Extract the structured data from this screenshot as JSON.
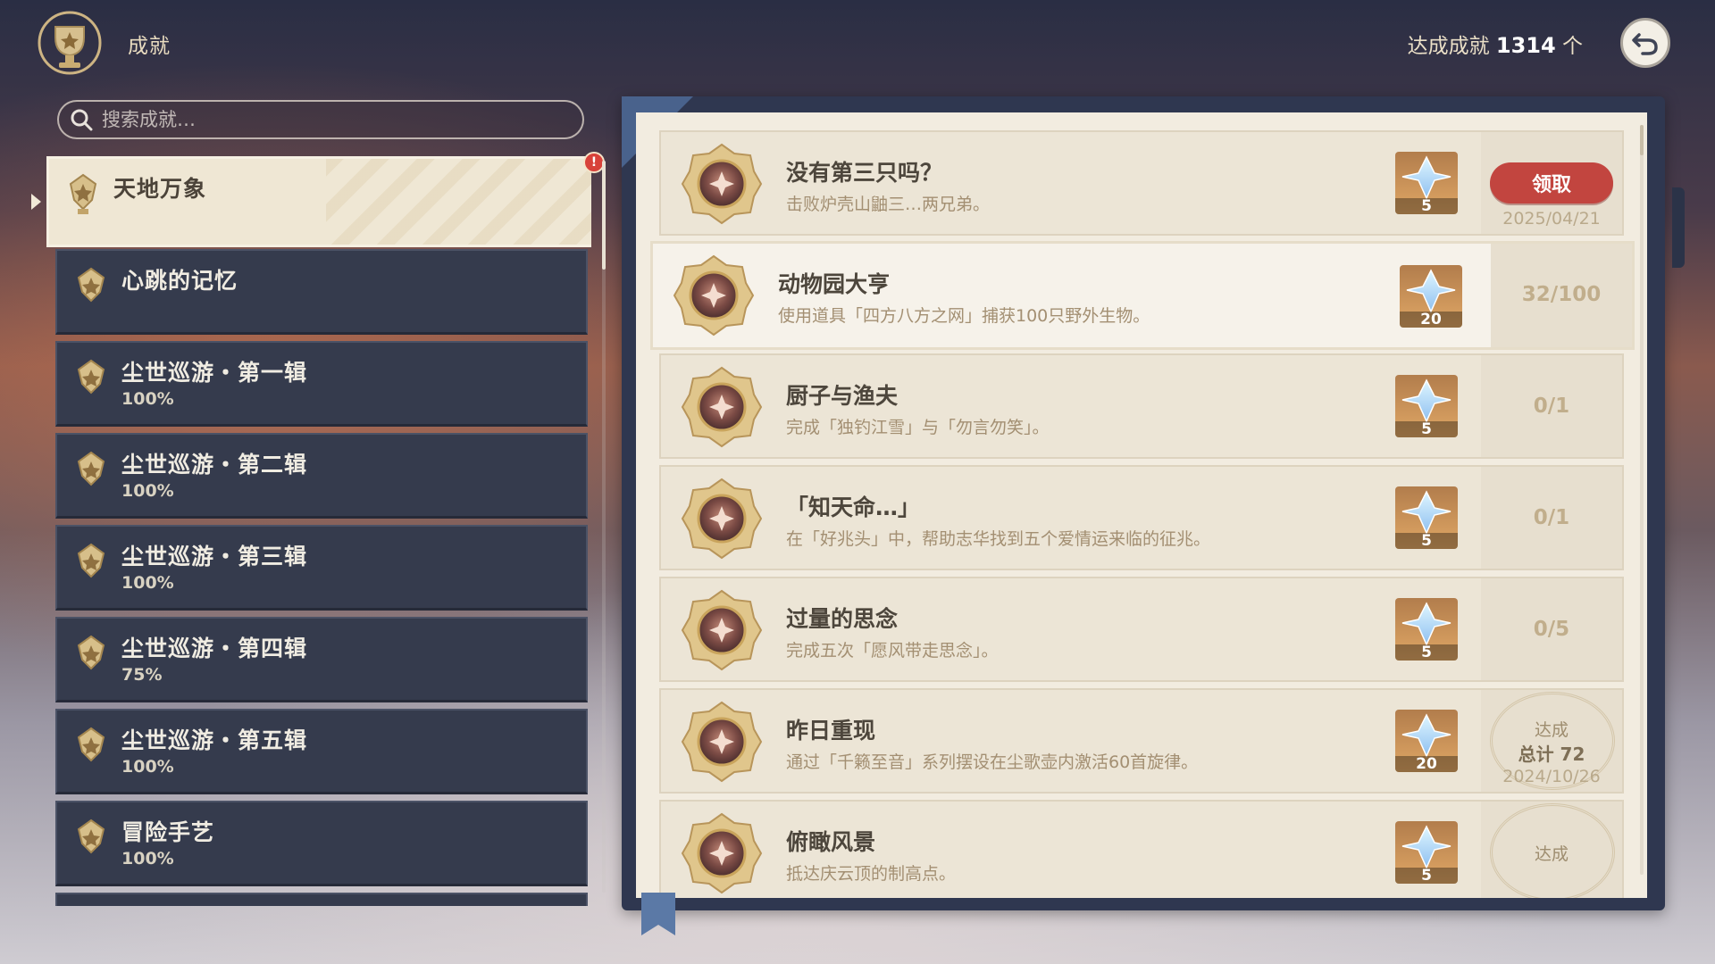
{
  "header": {
    "title": "成就",
    "achieved_label": "达成成就",
    "achieved_count": "1314",
    "achieved_unit": "个"
  },
  "search": {
    "placeholder": "搜索成就…"
  },
  "categories": [
    {
      "name": "天地万象",
      "percent": "",
      "active": true
    },
    {
      "name": "心跳的记忆",
      "percent": ""
    },
    {
      "name": "尘世巡游・第一辑",
      "percent": "100%"
    },
    {
      "name": "尘世巡游・第二辑",
      "percent": "100%"
    },
    {
      "name": "尘世巡游・第三辑",
      "percent": "100%"
    },
    {
      "name": "尘世巡游・第四辑",
      "percent": "75%"
    },
    {
      "name": "尘世巡游・第五辑",
      "percent": "100%"
    },
    {
      "name": "冒险手艺",
      "percent": "100%"
    }
  ],
  "notification_badge": "!",
  "achievements": [
    {
      "title": "没有第三只吗？",
      "desc": "击败炉壳山鼬三…两兄弟。",
      "reward": "5",
      "claim_label": "领取",
      "date": "2025/04/21"
    },
    {
      "title": "动物园大亨",
      "desc": "使用道具「四方八方之网」捕获100只野外生物。",
      "reward": "20",
      "progress": "32/100"
    },
    {
      "title": "厨子与渔夫",
      "desc": "完成「独钓江雪」与「勿言勿笑」。",
      "reward": "5",
      "progress": "0/1"
    },
    {
      "title": "「知天命…」",
      "desc": "在「好兆头」中，帮助志华找到五个爱情运来临的征兆。",
      "reward": "5",
      "progress": "0/1"
    },
    {
      "title": "过量的思念",
      "desc": "完成五次「愿风带走思念」。",
      "reward": "5",
      "progress": "0/5"
    },
    {
      "title": "昨日重现",
      "desc": "通过「千籁至音」系列摆设在尘歌壶内激活60首旋律。",
      "reward": "20",
      "status_label": "达成",
      "total_label": "总计 72",
      "date": "2024/10/26"
    },
    {
      "title": "俯瞰风景",
      "desc": "抵达庆云顶的制高点。",
      "reward": "5",
      "status_label": "达成"
    }
  ],
  "colors": {
    "accent_red": "#c2453f",
    "panel_navy": "#2f3750",
    "page_cream": "#f2ece0",
    "gold": "#c9a45c"
  },
  "icons": [
    "trophy-emblem-icon",
    "back-arrow-icon",
    "search-icon",
    "achievement-category-icon",
    "achievement-medal-icon",
    "primogem-icon"
  ]
}
